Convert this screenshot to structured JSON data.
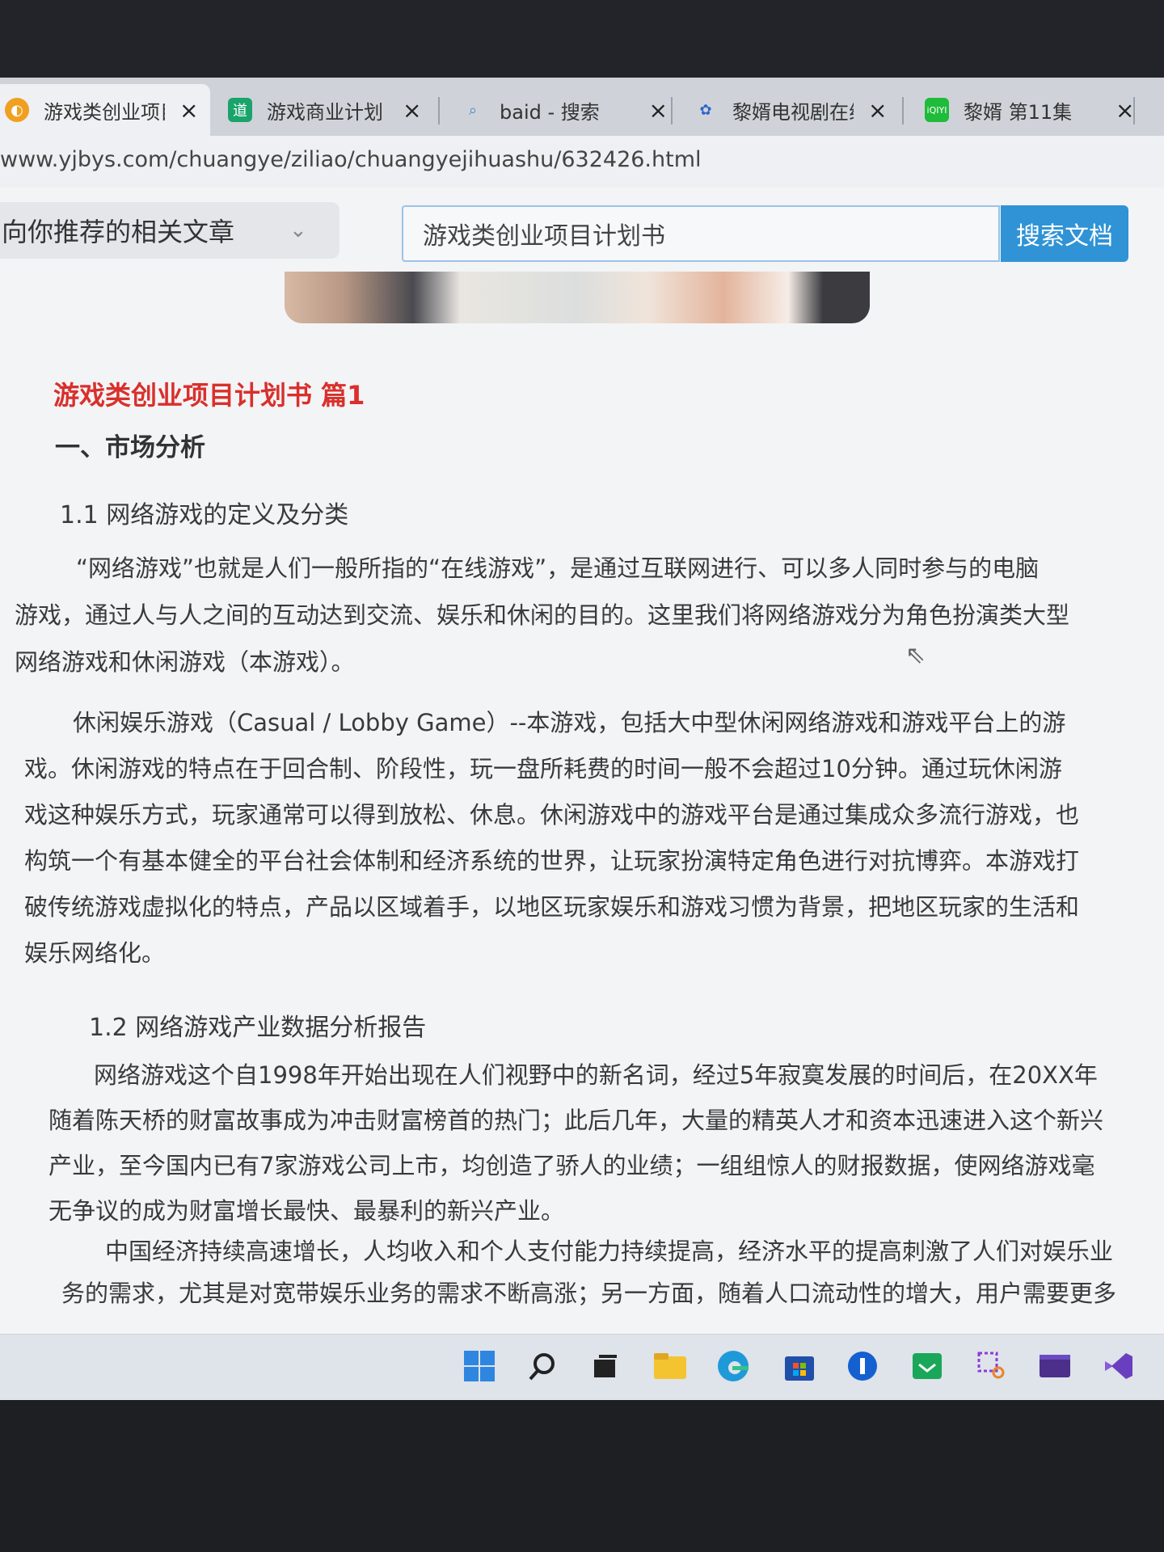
{
  "browser": {
    "tabs": [
      {
        "label": "游戏类创业项目",
        "icon": "browser-logo-icon",
        "active": true
      },
      {
        "label": "游戏商业计划",
        "icon": "doc-icon"
      },
      {
        "label": "baid - 搜索",
        "icon": "search-icon"
      },
      {
        "label": "黎婿电视剧在线",
        "icon": "baidu-paw-icon"
      },
      {
        "label": "黎婿 第11集",
        "icon": "iqiyi-icon"
      }
    ],
    "close_glyph": "×",
    "url": "www.yjbys.com/chuangye/ziliao/chuangyejihuashu/632426.html"
  },
  "page": {
    "recommend_label": "向你推荐的相关文章",
    "search_value": "游戏类创业项目计划书",
    "search_button": "搜索文档",
    "article": {
      "title": "游戏类创业项目计划书 篇1",
      "section1": "一、市场分析",
      "sub1": "1.1 网络游戏的定义及分类",
      "para1": [
        "“网络游戏”也就是人们一般所指的“在线游戏”，是通过互联网进行、可以多人同时参与的电脑",
        "游戏，通过人与人之间的互动达到交流、娱乐和休闲的目的。这里我们将网络游戏分为角色扮演类大型",
        "网络游戏和休闲游戏（本游戏）。"
      ],
      "para2": [
        "休闲娱乐游戏（Casual / Lobby Game）--本游戏，包括大中型休闲网络游戏和游戏平台上的游",
        "戏。休闲游戏的特点在于回合制、阶段性，玩一盘所耗费的时间一般不会超过10分钟。通过玩休闲游",
        "戏这种娱乐方式，玩家通常可以得到放松、休息。休闲游戏中的游戏平台是通过集成众多流行游戏，也",
        "构筑一个有基本健全的平台社会体制和经济系统的世界，让玩家扮演特定角色进行对抗博弈。本游戏打",
        "破传统游戏虚拟化的特点，产品以区域着手，以地区玩家娱乐和游戏习惯为背景，把地区玩家的生活和",
        "娱乐网络化。"
      ],
      "sub2": "1.2 网络游戏产业数据分析报告",
      "para3": [
        "网络游戏这个自1998年开始出现在人们视野中的新名词，经过5年寂寞发展的时间后，在20XX年",
        "随着陈天桥的财富故事成为冲击财富榜首的热门；此后几年，大量的精英人才和资本迅速进入这个新兴",
        "产业，至今国内已有7家游戏公司上市，均创造了骄人的业绩；一组组惊人的财报数据，使网络游戏毫",
        "无争议的成为财富增长最快、最暴利的新兴产业。"
      ],
      "para4": [
        "中国经济持续高速增长，人均收入和个人支付能力持续提高，经济水平的提高刺激了人们对娱乐业",
        "务的需求，尤其是对宽带娱乐业务的需求不断高涨；另一方面，随着人口流动性的增大，用户需要更多"
      ]
    }
  },
  "taskbar": {
    "icons": [
      "windows-start-icon",
      "search-icon",
      "task-view-icon",
      "file-explorer-icon",
      "edge-browser-icon",
      "store-icon",
      "app-blue-icon",
      "app-green-icon",
      "snipping-tool-icon",
      "terminal-icon",
      "visual-studio-icon"
    ]
  },
  "colors": {
    "accent": "#2f93d6",
    "title_red": "#d9302c"
  }
}
